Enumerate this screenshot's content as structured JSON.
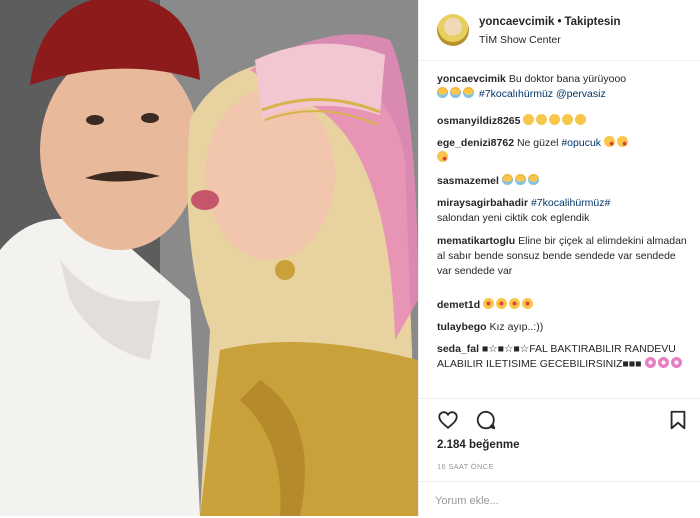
{
  "post": {
    "username": "yoncaevcimik",
    "follow_status": "Takiptesin",
    "location": "TİM Show Center"
  },
  "comments": [
    {
      "user": "yoncaevcimik",
      "text": "Bu doktor bana yürüyooo",
      "line2_tags": "#7kocalıhürmüz @pervasiz",
      "emoji": [
        "crying-laughing",
        "crying-laughing",
        "crying-laughing"
      ]
    },
    {
      "user": "osmanyildiz8265",
      "text": "",
      "emoji": [
        "sad",
        "sad",
        "sad",
        "sad",
        "sad"
      ]
    },
    {
      "user": "ege_denizi8762",
      "text": "Ne güzel",
      "tag": "#opucuk",
      "emoji": [
        "kiss",
        "kiss",
        "kiss"
      ]
    },
    {
      "user": "sasmazemel",
      "text": "",
      "emoji": [
        "crying-laughing",
        "crying-laughing",
        "crying-laughing"
      ]
    },
    {
      "user": "miraysagirbahadir",
      "tag": "#7kocalihürmüz#",
      "text": "salondan yeni ciktik cok eglendik"
    },
    {
      "user": "mematikartoglu",
      "text": "Eline bir çiçek al elimdekini almadan al sabır bende sonsuz bende sendede var sendede var sendede var"
    },
    {
      "user": "demet1d",
      "text": "",
      "emoji": [
        "heart-eyes",
        "heart-eyes",
        "heart-eyes",
        "heart-eyes"
      ]
    },
    {
      "user": "tulaybego",
      "text": "Kız ayıp..:))"
    },
    {
      "user": "seda_fal",
      "text": "■☆■☆■☆FAL BAKTIRABILIR RANDEVU ALABILIR ILETISIME GECEBILIRSINIZ■■■",
      "emoji": [
        "flower",
        "flower",
        "flower"
      ]
    }
  ],
  "likes": "2.184 beğenme",
  "time": "16 SAAT ÖNCE",
  "add_comment_placeholder": "Yorum ekle...",
  "icons": {
    "like": "heart-icon",
    "comment": "comment-icon",
    "save": "bookmark-icon"
  },
  "colors": {
    "hashtag": "#003569",
    "text": "#262626",
    "muted": "#999999",
    "border": "#efefef"
  }
}
